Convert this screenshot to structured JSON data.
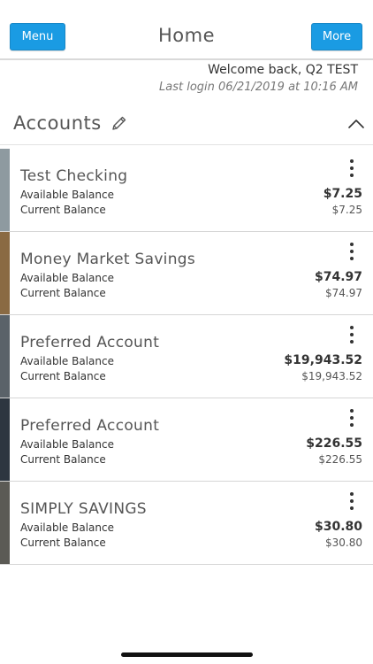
{
  "header": {
    "menu_label": "Menu",
    "title": "Home",
    "more_label": "More"
  },
  "welcome": {
    "greeting": "Welcome back, Q2 TEST",
    "last_login": "Last login 06/21/2019 at 10:16 AM"
  },
  "accounts": {
    "title": "Accounts",
    "items": [
      {
        "name": "Test Checking",
        "available_label": "Available Balance",
        "available": "$7.25",
        "current_label": "Current Balance",
        "current": "$7.25",
        "color": "#8e9aa0"
      },
      {
        "name": "Money Market Savings",
        "available_label": "Available Balance",
        "available": "$74.97",
        "current_label": "Current Balance",
        "current": "$74.97",
        "color": "#8a6a43"
      },
      {
        "name": "Preferred Account",
        "available_label": "Available Balance",
        "available": "$19,943.52",
        "current_label": "Current Balance",
        "current": "$19,943.52",
        "color": "#5a6269"
      },
      {
        "name": "Preferred Account",
        "available_label": "Available Balance",
        "available": "$226.55",
        "current_label": "Current Balance",
        "current": "$226.55",
        "color": "#2d3640"
      },
      {
        "name": "SIMPLY SAVINGS",
        "available_label": "Available Balance",
        "available": "$30.80",
        "current_label": "Current Balance",
        "current": "$30.80",
        "color": "#5b5a55"
      }
    ]
  },
  "icons": {
    "edit": "pencil-icon",
    "collapse": "chevron-up-icon",
    "options": "kebab-menu-icon"
  }
}
